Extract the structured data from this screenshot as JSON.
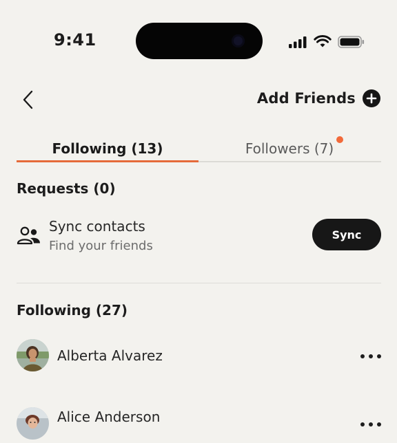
{
  "status_bar": {
    "time": "9:41",
    "icons": [
      "signal-icon",
      "wifi-icon",
      "battery-icon"
    ]
  },
  "header": {
    "back_icon": "chevron-left-icon",
    "add_friends_label": "Add Friends",
    "add_icon": "plus-circle-icon"
  },
  "tabs": [
    {
      "label": "Following (13)",
      "active": true
    },
    {
      "label": "Followers (7)",
      "active": false,
      "has_notification": true
    }
  ],
  "requests": {
    "title": "Requests (0)"
  },
  "sync": {
    "icon": "contacts-icon",
    "title": "Sync contacts",
    "subtitle": "Find your friends",
    "button_label": "Sync"
  },
  "following": {
    "title": "Following (27)",
    "items": [
      {
        "name": "Alberta Alvarez",
        "avatar": "avatar-photo",
        "more_icon": "more-horizontal-icon"
      },
      {
        "name": "Alice Anderson",
        "avatar": "avatar-photo",
        "more_icon": "more-horizontal-icon"
      }
    ]
  },
  "colors": {
    "background": "#f3f2ee",
    "accent": "#e56a3a",
    "notification_dot": "#f26a3a",
    "button_dark": "#171717",
    "text_primary": "#1c1c1c",
    "text_secondary": "#6c6c6c"
  }
}
